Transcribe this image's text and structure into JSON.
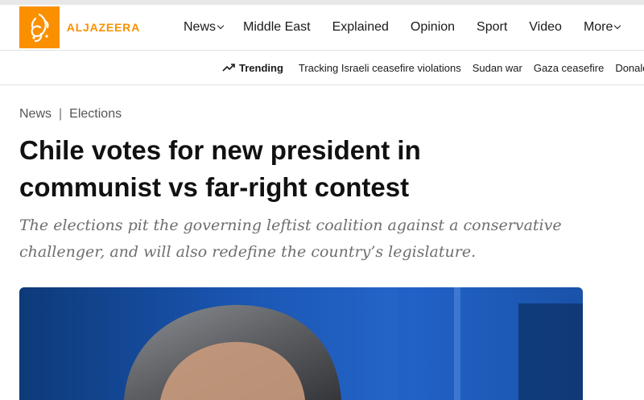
{
  "brand": {
    "name": "ALJAZEERA",
    "color": "#fa9000"
  },
  "nav": {
    "items": [
      {
        "label": "News",
        "has_dropdown": true
      },
      {
        "label": "Middle East",
        "has_dropdown": false
      },
      {
        "label": "Explained",
        "has_dropdown": false
      },
      {
        "label": "Opinion",
        "has_dropdown": false
      },
      {
        "label": "Sport",
        "has_dropdown": false
      },
      {
        "label": "Video",
        "has_dropdown": false
      },
      {
        "label": "More",
        "has_dropdown": true
      }
    ]
  },
  "trending": {
    "label": "Trending",
    "icon": "trending-up-icon",
    "links": [
      "Tracking Israeli ceasefire violations",
      "Sudan war",
      "Gaza ceasefire",
      "Donald Trump"
    ]
  },
  "article": {
    "breadcrumb": [
      "News",
      "Elections"
    ],
    "title": "Chile votes for new president in communist vs far-right contest",
    "subtitle": "The elections pit the governing leftist coalition against a conservative challenger, and will also redefine the country’s legislature."
  }
}
